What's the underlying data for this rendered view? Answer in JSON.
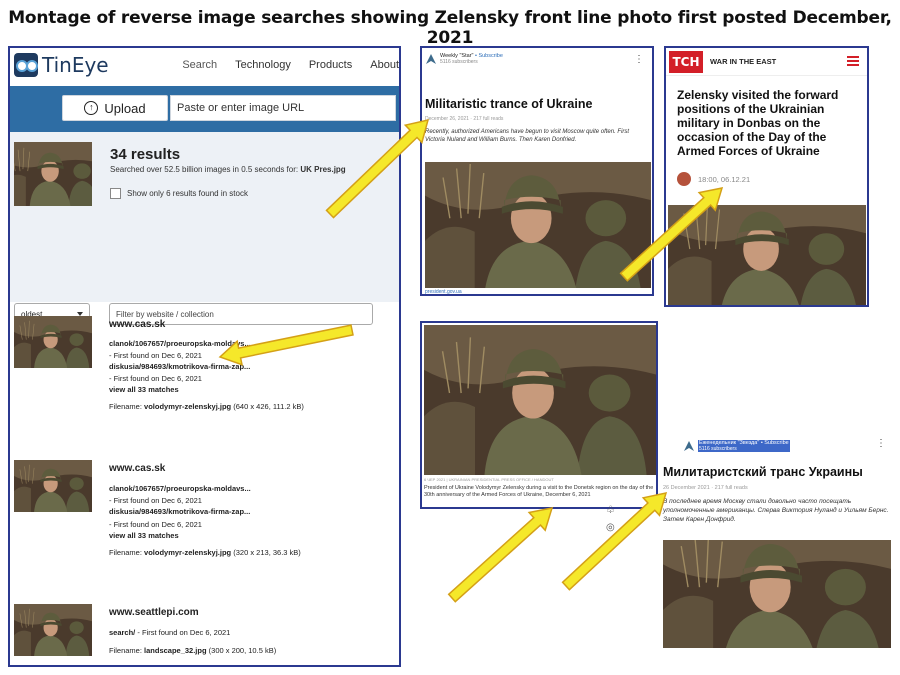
{
  "page_title": "Montage of reverse image searches showing Zelensky front line photo first posted December, 2021",
  "tineye": {
    "logo_text": "TinEye",
    "nav": [
      "Search",
      "Technology",
      "Products",
      "About"
    ],
    "upload_label": "Upload",
    "url_placeholder": "Paste or enter image URL",
    "results_count": "34 results",
    "searched_text": "Searched over 52.5 billion images in 0.5 seconds for:",
    "searched_file": "UK Pres.jpg",
    "stock_label": "Show only 6 results found in stock",
    "sort_value": "oldest",
    "filter_placeholder": "Filter by website / collection",
    "results": [
      {
        "domain": "www.cas.sk",
        "link1": "clanok/1067657/proeuropska-moldavs...",
        "found1": "- First found on Dec 6, 2021",
        "link2": "diskusia/984693/kmotrikova-firma-zap...",
        "found2": "- First found on Dec 6, 2021",
        "matches": "view all 33 matches",
        "filename_label": "Filename:",
        "filename": "volodymyr-zelenskyj.jpg",
        "size": "(640 x 426, 111.2 kB)"
      },
      {
        "domain": "www.cas.sk",
        "link1": "clanok/1067657/proeuropska-moldavs...",
        "found1": "- First found on Dec 6, 2021",
        "link2": "diskusia/984693/kmotrikova-firma-zap...",
        "found2": "- First found on Dec 6, 2021",
        "matches": "view all 33 matches",
        "filename_label": "Filename:",
        "filename": "volodymyr-zelenskyj.jpg",
        "size": "(320 x 213, 36.3 kB)"
      },
      {
        "domain": "www.seattlepi.com",
        "link1": "search/",
        "found1": "- First found on Dec 6, 2021",
        "filename_label": "Filename:",
        "filename": "landscape_32.jpg",
        "size": "(300 x 200, 10.5 kB)"
      }
    ]
  },
  "weekly_star_en": {
    "publisher": "Weekly \"Star\"",
    "subscribe": "• Subscribe",
    "subscribers": "5116 subscribers",
    "headline": "Militaristic trance of Ukraine",
    "meta": "December 26, 2021 · 217 full reads",
    "lead": "Recently, authorized Americans have begun to visit Moscow quite often. First Victoria Nuland and William Burns. Then Karen Donfried.",
    "credit": "president.gov.ua"
  },
  "tch": {
    "logo": "ТСН",
    "section": "WAR IN THE EAST",
    "headline": "Zelensky visited the forward positions of the Ukrainian military in Donbas on the occasion of the Day of the Armed Forces of Ukraine",
    "time": "18:00, 06.12.21"
  },
  "caption_card": {
    "tiny": "6 ЧЕР 2021 | UKRAINIAN PRESIDENTIAL PRESS OFFICE / HANDOUT",
    "caption": "President of Ukraine Volodymyr Zelensky during a visit to the Donetsk region on the day of the 30th anniversary of the Armed Forces of Ukraine, December 6, 2021"
  },
  "weekly_star_ru": {
    "publisher": "Еженедельник \"Звезда\"",
    "subscribe": "• Subscribe",
    "subscribers": "5116 subscribers",
    "headline": "Милитаристский транс Украины",
    "meta": "26 December 2021 · 217 full reads",
    "lead": "В последнее время Москву стали довольно часто посещать уполномоченные американцы. Сперва Виктория Нуланд и Уильям Бернс. Затем Карен Донфрид."
  },
  "colors": {
    "frame_blue": "#2b3990",
    "tineye_bar": "#2e6da4",
    "arrow_fill": "#f5e82a",
    "arrow_stroke": "#d4a017",
    "tch_red": "#d31f28"
  }
}
